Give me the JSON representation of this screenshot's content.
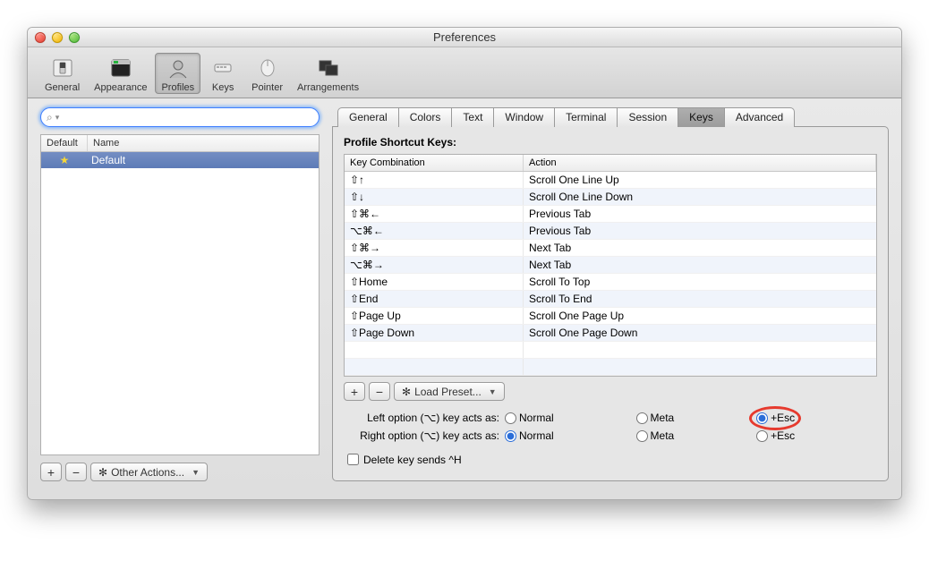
{
  "window": {
    "title": "Preferences"
  },
  "toolbar": {
    "items": [
      {
        "label": "General"
      },
      {
        "label": "Appearance"
      },
      {
        "label": "Profiles"
      },
      {
        "label": "Keys"
      },
      {
        "label": "Pointer"
      },
      {
        "label": "Arrangements"
      }
    ],
    "selected": 2
  },
  "sidebar": {
    "search_placeholder": "",
    "columns": {
      "default": "Default",
      "name": "Name"
    },
    "rows": [
      {
        "name": "Default",
        "starred": true,
        "selected": true
      }
    ],
    "add_label": "+",
    "remove_label": "−",
    "other_actions_label": "Other Actions..."
  },
  "profile_tabs": {
    "items": [
      "General",
      "Colors",
      "Text",
      "Window",
      "Terminal",
      "Session",
      "Keys",
      "Advanced"
    ],
    "selected": 6
  },
  "keys_panel": {
    "heading": "Profile Shortcut Keys:",
    "columns": {
      "combo": "Key Combination",
      "action": "Action"
    },
    "rows": [
      {
        "combo": "⇧↑",
        "action": "Scroll One Line Up"
      },
      {
        "combo": "⇧↓",
        "action": "Scroll One Line Down"
      },
      {
        "combo": "⇧⌘←",
        "action": "Previous Tab"
      },
      {
        "combo": "⌥⌘←",
        "action": "Previous Tab"
      },
      {
        "combo": "⇧⌘→",
        "action": "Next Tab"
      },
      {
        "combo": "⌥⌘→",
        "action": "Next Tab"
      },
      {
        "combo": "⇧Home",
        "action": "Scroll To Top"
      },
      {
        "combo": "⇧End",
        "action": "Scroll To End"
      },
      {
        "combo": "⇧Page Up",
        "action": "Scroll One Page Up"
      },
      {
        "combo": "⇧Page Down",
        "action": "Scroll One Page Down"
      }
    ],
    "add_label": "+",
    "remove_label": "−",
    "load_preset_label": "Load Preset...",
    "left_option_label": "Left option (⌥) key acts as:",
    "right_option_label": "Right option (⌥) key acts as:",
    "radio_options": {
      "normal": "Normal",
      "meta": "Meta",
      "esc": "+Esc"
    },
    "left_option_selected": "esc",
    "right_option_selected": "normal",
    "delete_label": "Delete key sends ^H",
    "delete_checked": false,
    "highlight": "left_option_esc"
  }
}
